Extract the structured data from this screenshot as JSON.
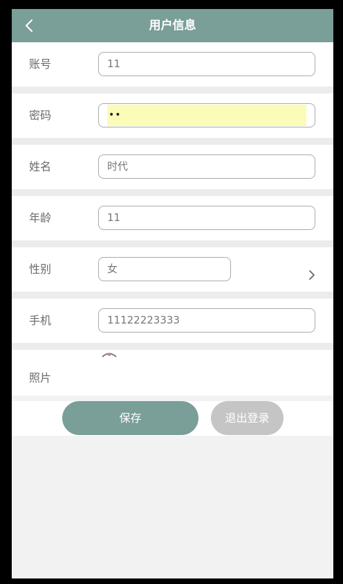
{
  "header": {
    "title": "用户信息"
  },
  "fields": [
    {
      "label": "账号",
      "value": "11"
    },
    {
      "label": "密码",
      "value": "••"
    },
    {
      "label": "姓名",
      "value": "时代"
    },
    {
      "label": "年龄",
      "value": "11"
    },
    {
      "label": "性别",
      "value": "女"
    },
    {
      "label": "手机",
      "value": "11122223333"
    }
  ],
  "photo": {
    "label": "照片"
  },
  "buttons": {
    "save": "保存",
    "logout": "退出登录"
  },
  "colors": {
    "header_bg": "#7a9e98",
    "save_bg": "#7a9e98",
    "logout_bg": "#c5c5c5",
    "autofill_bg": "#fafcb7"
  },
  "icons": {
    "back": "chevron-left-icon",
    "gender_select": "chevron-right-icon"
  }
}
